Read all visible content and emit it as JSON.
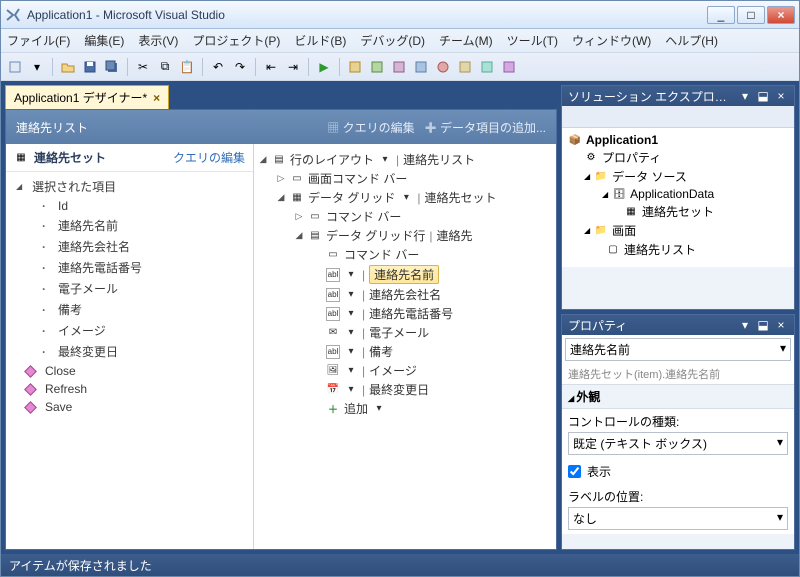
{
  "window": {
    "title": "Application1 - Microsoft Visual Studio",
    "min": "_",
    "max": "□",
    "close": "×"
  },
  "menu": {
    "file": "ファイル(F)",
    "edit": "編集(E)",
    "view": "表示(V)",
    "project": "プロジェクト(P)",
    "build": "ビルド(B)",
    "debug": "デバッグ(D)",
    "team": "チーム(M)",
    "tools": "ツール(T)",
    "window": "ウィンドウ(W)",
    "help": "ヘルプ(H)"
  },
  "doc": {
    "tab": "Application1 デザイナー*",
    "title": "連絡先リスト",
    "query_edit": "クエリの編集",
    "add_data_item": "データ項目の追加..."
  },
  "left": {
    "set_name": "連絡先セット",
    "edit_query": "クエリの編集",
    "selected_item": "選択された項目",
    "fields": [
      "Id",
      "連絡先名前",
      "連絡先会社名",
      "連絡先電話番号",
      "電子メール",
      "備考",
      "イメージ",
      "最終変更日"
    ],
    "cmds": [
      "Close",
      "Refresh",
      "Save"
    ]
  },
  "mid": {
    "row_layout": "行のレイアウト",
    "row_layout_target": "連絡先リスト",
    "screen_cmd_bar": "画面コマンド バー",
    "data_grid": "データ グリッド",
    "data_grid_target": "連絡先セット",
    "cmd_bar": "コマンド バー",
    "data_grid_row": "データ グリッド行",
    "data_grid_row_target": "連絡先",
    "cmd_bar2": "コマンド バー",
    "fields": [
      "連絡先名前",
      "連絡先会社名",
      "連絡先電話番号",
      "電子メール",
      "備考",
      "イメージ",
      "最終変更日"
    ],
    "add": "追加"
  },
  "solution": {
    "title": "ソリューション エクスプロ…",
    "app": "Application1",
    "properties": "プロパティ",
    "datasources": "データ ソース",
    "appdata": "ApplicationData",
    "set": "連絡先セット",
    "screens": "画面",
    "screen": "連絡先リスト"
  },
  "props": {
    "title": "プロパティ",
    "selected": "連絡先名前",
    "dimmed": "連絡先セット(item).連絡先名前",
    "section": "外観",
    "control_type_label": "コントロールの種類:",
    "control_type_value": "既定 (テキスト ボックス)",
    "show_label": "表示",
    "label_pos_label": "ラベルの位置:",
    "label_pos_value": "なし"
  },
  "status": "アイテムが保存されました",
  "icons": {
    "grid": "▦",
    "cmdbar": "▭",
    "row": "▤",
    "abl": "abl",
    "img": "🖼",
    "date": "📅",
    "plus": "＋",
    "folder": "📁",
    "db": "🗄",
    "screen": "▢",
    "proj": "📦",
    "gear": "⚙",
    "dropdown": "▾"
  }
}
